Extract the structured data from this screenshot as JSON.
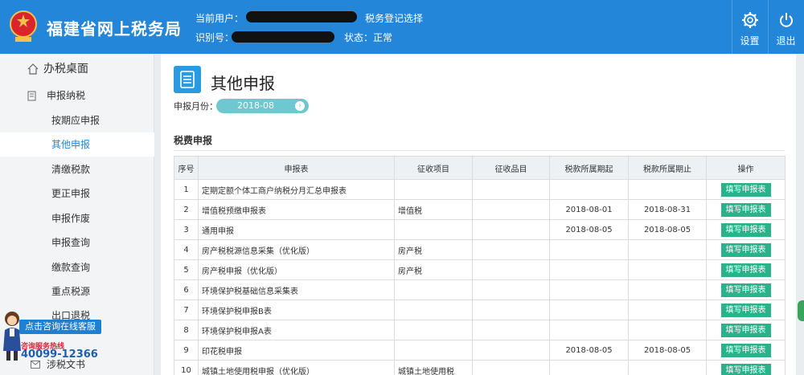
{
  "header": {
    "site_title": "福建省网上税务局",
    "current_user_label": "当前用户：",
    "tax_registration_link": "税务登记选择",
    "id_label": "识别号：",
    "status_label": "状态：正常",
    "settings_label": "设置",
    "logout_label": "退出"
  },
  "sidebar": {
    "desk": "办税桌面",
    "filing": "申报纳税",
    "items": [
      "按期应申报",
      "其他申报",
      "清缴税款",
      "更正申报",
      "申报作废",
      "申报查询",
      "缴款查询",
      "重点税源",
      "出口退税"
    ],
    "documents": "涉税文书"
  },
  "consult": {
    "banner": "点击咨询在线客服",
    "hotline_label": "咨询服务热线",
    "phone": "40099-12366"
  },
  "main": {
    "title": "其他申报",
    "month_label": "申报月份：",
    "month_value": "2018-08",
    "section_title": "税费申报"
  },
  "table": {
    "headers": [
      "序号",
      "申报表",
      "征收项目",
      "征收品目",
      "税款所属期起",
      "税款所属期止",
      "操作"
    ],
    "action_label": "填写申报表",
    "rows": [
      [
        "1",
        "定期定额个体工商户纳税分月汇总申报表",
        "",
        "",
        "",
        ""
      ],
      [
        "2",
        "增值税预缴申报表",
        "增值税",
        "",
        "2018-08-01",
        "2018-08-31"
      ],
      [
        "3",
        "通用申报",
        "",
        "",
        "2018-08-05",
        "2018-08-05"
      ],
      [
        "4",
        "房产税税源信息采集（优化版）",
        "房产税",
        "",
        "",
        ""
      ],
      [
        "5",
        "房产税申报（优化版）",
        "房产税",
        "",
        "",
        ""
      ],
      [
        "6",
        "环境保护税基础信息采集表",
        "",
        "",
        "",
        ""
      ],
      [
        "7",
        "环境保护税申报B表",
        "",
        "",
        "",
        ""
      ],
      [
        "8",
        "环境保护税申报A表",
        "",
        "",
        "",
        ""
      ],
      [
        "9",
        "印花税申报",
        "",
        "",
        "2018-08-05",
        "2018-08-05"
      ],
      [
        "10",
        "城镇土地使用税申报（优化版）",
        "城镇土地使用税",
        "",
        "",
        ""
      ]
    ]
  },
  "colors": {
    "header_bg": "#2486d9",
    "action_button": "#2ab28a",
    "month_pill": "#6fc7cf",
    "active_item": "#2486d9"
  }
}
